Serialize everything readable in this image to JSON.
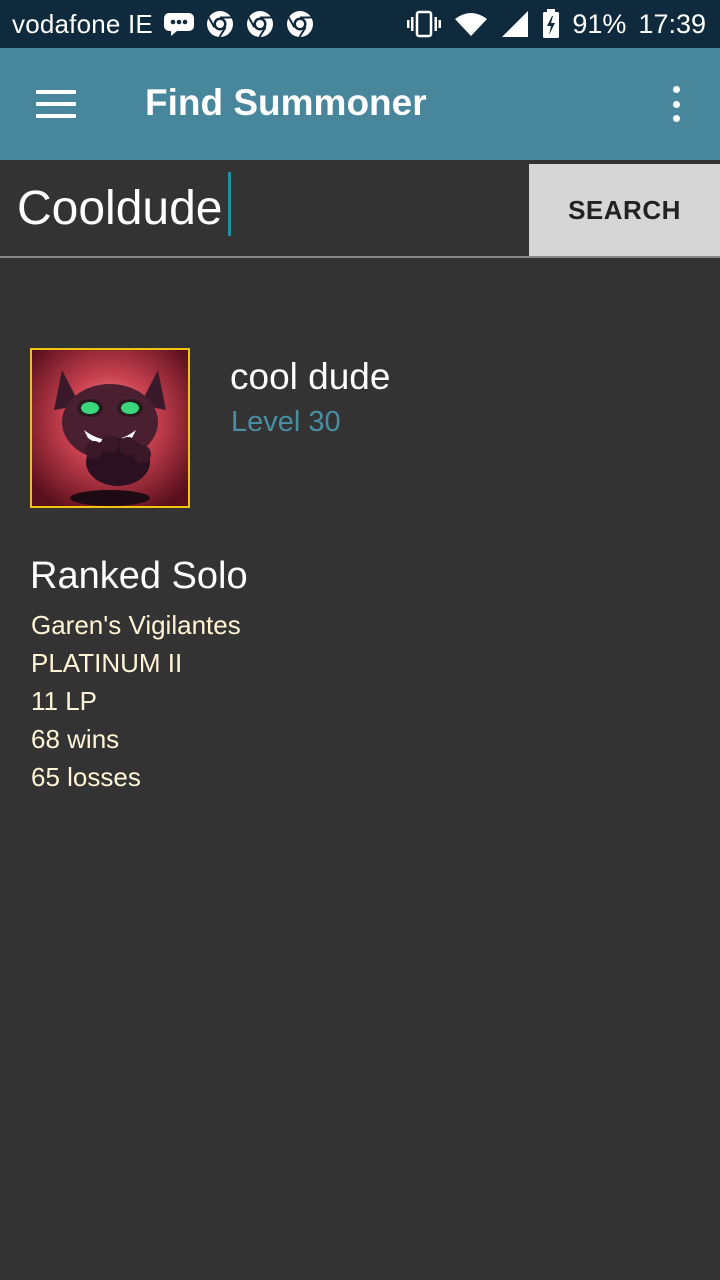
{
  "status_bar": {
    "carrier": "vodafone IE",
    "battery": "91%",
    "time": "17:39",
    "icons": [
      "messages-icon",
      "chrome-icon",
      "chrome-icon",
      "chrome-icon",
      "vibrate-icon",
      "wifi-icon",
      "signal-icon",
      "battery-charging-icon"
    ]
  },
  "app_bar": {
    "title": "Find Summoner"
  },
  "search": {
    "value": "Cooldude",
    "button_label": "SEARCH"
  },
  "summoner": {
    "name": "cool dude",
    "level": "Level 30"
  },
  "ranked": {
    "title": "Ranked Solo",
    "league": "Garen's Vigilantes",
    "tier": "PLATINUM II",
    "lp": "11 LP",
    "wins": "68 wins",
    "losses": "65 losses"
  },
  "colors": {
    "status_bar": "#0f2a3c",
    "app_bar": "#48869b",
    "background": "#333333",
    "level_text": "#4a8ea3",
    "ranked_text": "#fff4d6",
    "avatar_border": "#f1c40f"
  }
}
